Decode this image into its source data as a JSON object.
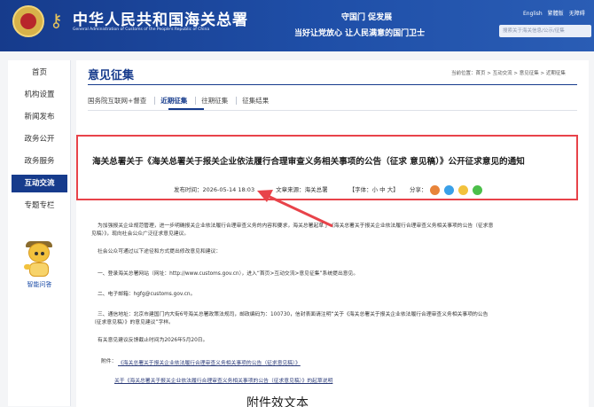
{
  "header": {
    "site_title": "中华人民共和国海关总署",
    "site_subtitle": "General Administration of Customs of the People's Republic of China",
    "slogan_line1": "守国门  促发展",
    "slogan_line2": "当好让党放心  让人民满意的国门卫士",
    "top_links": [
      "English",
      "繁體版",
      "无障碍"
    ],
    "search_placeholder": "搜索关于海关信息/公示/征集"
  },
  "sidebar": {
    "items": [
      {
        "label": "首页",
        "active": false
      },
      {
        "label": "机构设置",
        "active": false
      },
      {
        "label": "新闻发布",
        "active": false
      },
      {
        "label": "政务公开",
        "active": false
      },
      {
        "label": "政务服务",
        "active": false
      },
      {
        "label": "互动交流",
        "active": true
      },
      {
        "label": "专题专栏",
        "active": false
      }
    ],
    "assistant_label": "智能问答"
  },
  "main": {
    "page_title": "意见征集",
    "breadcrumb": "当前位置：首页 > 互动交流 > 意见征集 > 近期征集",
    "tabs": [
      {
        "label": "国务院互联网+督查",
        "active": false
      },
      {
        "label": "近期征集",
        "active": true
      },
      {
        "label": "往期征集",
        "active": false
      },
      {
        "label": "征集结果",
        "active": false
      }
    ],
    "notice": {
      "title": "海关总署关于《海关总署关于报关企业依法履行合理审查义务相关事项的公告（征求 意见稿）》公开征求意见的通知",
      "publish_time_label": "发布时间：",
      "publish_time": "2026-05-14 18:03",
      "source_label": "文章来源：",
      "source": "海关总署",
      "font_size_label": "【字体：小 中 大】",
      "share_label": "分享："
    },
    "body": [
      "为加强报关企业规范管理，进一步明确报关企业依法履行合理审查义务的内容和要求，海关总署起草了《海关总署关于报关企业依法履行合理审查义务相关事项的公告（征求意",
      "见稿）》，现向社会公众广泛征求意见建议。",
      "社会公众可通过以下途径和方式提出修改意见和建议：",
      "一、登录海关总署网站（网址：http://www.customs.gov.cn），进入“首页>互动交流>意见征集”系统提出意见。",
      "二、电子邮箱：hgfg@customs.gov.cn。",
      "三、通信地址：北京市建国门内大街6号海关总署政策法规司，邮政编码为：100730，信封表面请注明“关于《海关总署关于报关企业依法履行合理审查义务相关事项的公告",
      "（征求意见稿）》的意见建议”字样。",
      "有关意见建议反馈截止时间为2026年5月20日。"
    ],
    "attachments_label": "附件：",
    "attachments": [
      "《海关总署关于报关企业依法履行合理审查义务相关事项的公告（征求意见稿）》",
      "关于《海关总署关于报关企业依法履行合理审查义务相关事项的公告（征求意见稿）》的起草说明"
    ],
    "overlay_caption": "附件效文本"
  },
  "colors": {
    "header_blue": "#163b8c",
    "highlight_red": "#e8434a",
    "link_blue": "#2a3a78"
  },
  "icons": [
    "national-emblem-icon",
    "customs-key-icon",
    "weibo-share-icon",
    "qq-share-icon",
    "qzone-share-icon",
    "wechat-share-icon",
    "assistant-robot-icon",
    "annotation-arrow-icon"
  ]
}
